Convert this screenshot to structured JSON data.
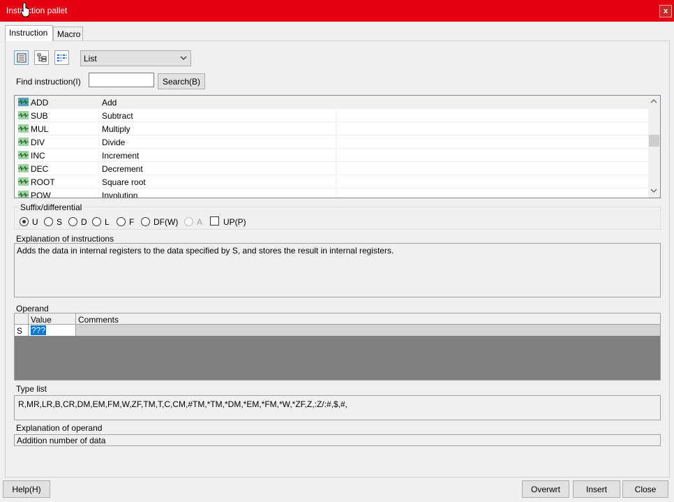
{
  "window": {
    "title": "Instruction pallet",
    "close_label": "x"
  },
  "tabs": [
    {
      "label": "Instruction"
    },
    {
      "label": "Macro"
    }
  ],
  "toolbar": {
    "view_select": "List"
  },
  "find": {
    "label": "Find instruction(I)",
    "value": "",
    "search_button": "Search(B)"
  },
  "instructions": [
    {
      "name": "ADD",
      "desc": "Add"
    },
    {
      "name": "SUB",
      "desc": "Subtract"
    },
    {
      "name": "MUL",
      "desc": "Multiply"
    },
    {
      "name": "DIV",
      "desc": "Divide"
    },
    {
      "name": "INC",
      "desc": "Increment"
    },
    {
      "name": "DEC",
      "desc": "Decrement"
    },
    {
      "name": "ROOT",
      "desc": "Square root"
    },
    {
      "name": "POW",
      "desc": "Involution"
    }
  ],
  "suffix": {
    "label": "Suffix/differential",
    "options": [
      "U",
      "S",
      "D",
      "L",
      "F",
      "DF(W)",
      "A"
    ],
    "selected": "U",
    "up_label": "UP(P)"
  },
  "explanation": {
    "label": "Explanation of instructions",
    "text": "Adds the data in internal registers to the data specified by S, and stores the result in internal registers."
  },
  "operand": {
    "label": "Operand",
    "columns": [
      "Value",
      "Comments"
    ],
    "rows": [
      {
        "name": "S",
        "value": "???",
        "comment": ""
      }
    ]
  },
  "type_list": {
    "label": "Type list",
    "text": "R,MR,LR,B,CR,DM,EM,FM,W,ZF,TM,T,C,CM,#TM,*TM,*DM,*EM,*FM,*W,*ZF,Z,:Z/:#,$,#,"
  },
  "operand_explanation": {
    "label": "Explanation of operand",
    "text": "Addition number of data"
  },
  "footer": {
    "help": "Help(H)",
    "overwrite": "Overwrt",
    "insert": "Insert",
    "close": "Close"
  },
  "colors": {
    "title_bar": "#e50012",
    "selection": "#0078d7",
    "instruction_icon": "#9fd3a2"
  }
}
